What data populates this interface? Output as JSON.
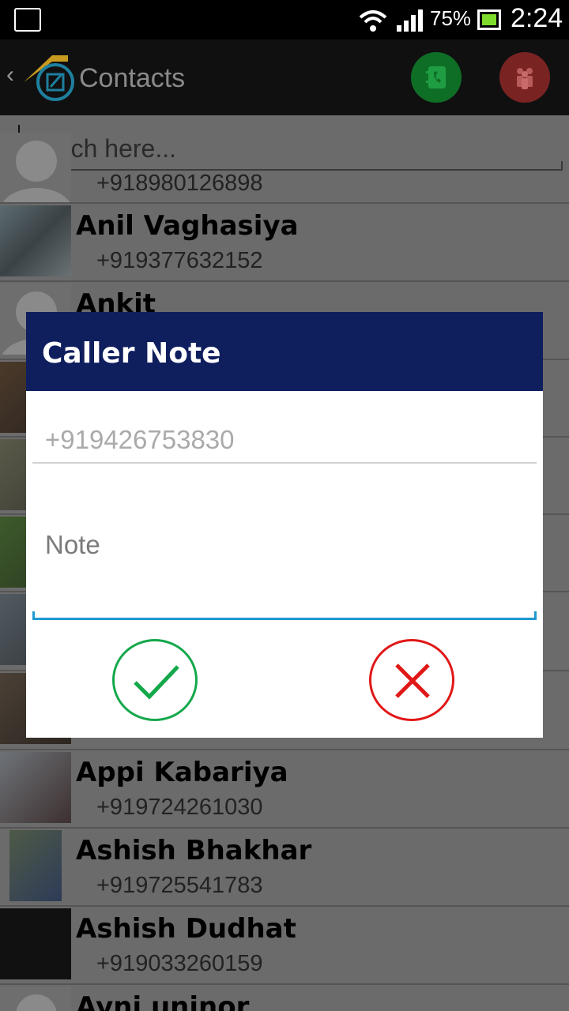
{
  "status_bar": {
    "battery_percent": "75%",
    "time": "2:24",
    "icons": [
      "image-icon",
      "wifi-icon",
      "signal-icon",
      "battery-icon"
    ]
  },
  "action_bar": {
    "back_glyph": "‹",
    "title": "Contacts",
    "icons": [
      "app-logo-icon",
      "contacts-book-icon",
      "groups-icon"
    ],
    "colors": {
      "contacts_button": "#0f6e26",
      "groups_button": "#7a2323"
    }
  },
  "search": {
    "placeholder": "Search here..."
  },
  "contacts": [
    {
      "name": "",
      "number": "+918980126898"
    },
    {
      "name": "Anil Vaghasiya",
      "number": "+919377632152"
    },
    {
      "name": "Ankit",
      "number": ""
    },
    {
      "name": "Appi Kabariya",
      "number": "+919724261030"
    },
    {
      "name": "Ashish Bhakhar",
      "number": "+919725541783"
    },
    {
      "name": "Ashish Dudhat",
      "number": "+919033260159"
    },
    {
      "name": "Ayni uninor",
      "number": ""
    }
  ],
  "dialog": {
    "title": "Caller Note",
    "phone_value": "+919426753830",
    "note_placeholder": "Note",
    "colors": {
      "header": "#0f1e5d",
      "ok": "#14a84b",
      "cancel": "#e01818",
      "focus_line": "#1e9ad0"
    }
  }
}
